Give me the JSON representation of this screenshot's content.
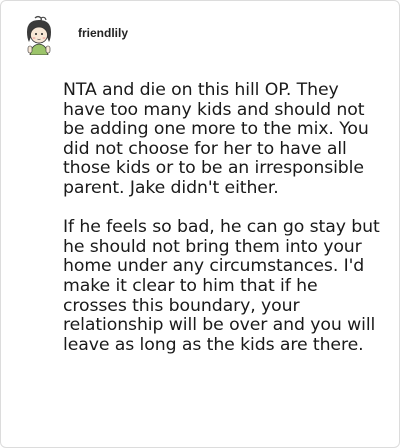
{
  "post": {
    "username": "friendlily",
    "paragraphs": [
      "NTA and die on this hill OP. They have too many kids and should not be adding one more to the mix. You did not choose for her to have all those kids or to be an irresponsible parent. Jake didn't either.",
      "If he feels so bad, he can go stay but he should not bring them into your home under any circumstances. I'd make it clear to him that if he crosses this boundary, your relationship will be over and you will leave as long as the kids are there."
    ]
  },
  "icons": {
    "avatar": "cartoon-avatar-icon"
  }
}
